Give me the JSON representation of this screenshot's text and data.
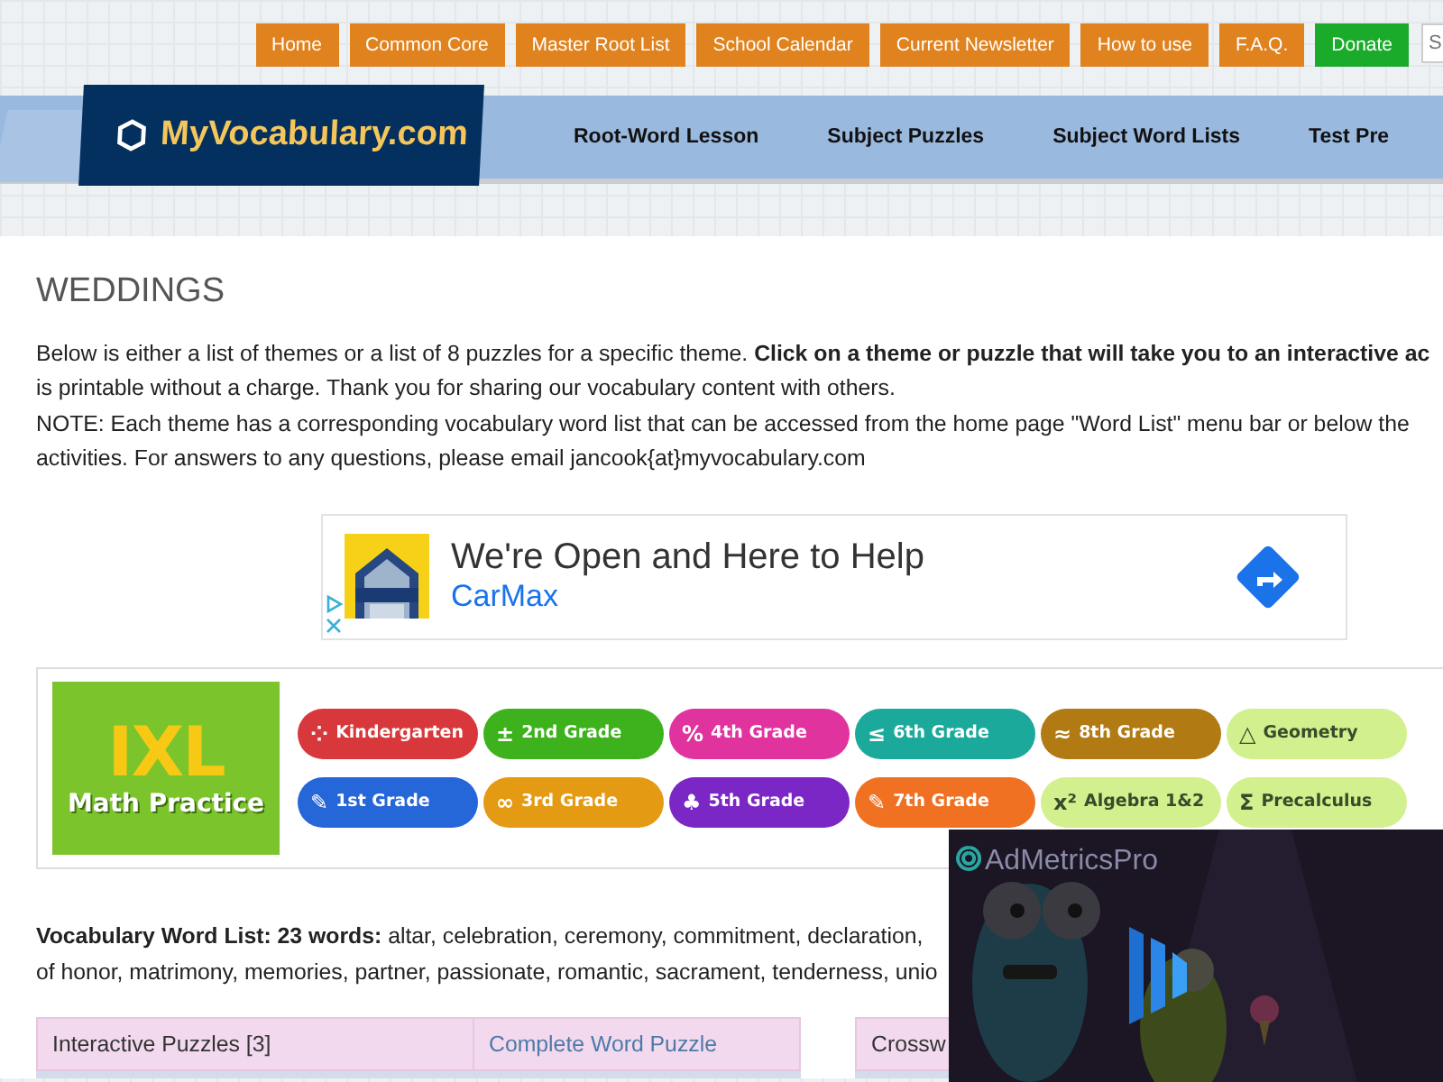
{
  "top_menu": [
    {
      "label": "Home",
      "kind": "normal"
    },
    {
      "label": "Common Core",
      "kind": "normal"
    },
    {
      "label": "Master Root List",
      "kind": "normal"
    },
    {
      "label": "School Calendar",
      "kind": "normal"
    },
    {
      "label": "Current Newsletter",
      "kind": "normal"
    },
    {
      "label": "How to use",
      "kind": "normal"
    },
    {
      "label": "F.A.Q.",
      "kind": "normal"
    },
    {
      "label": "Donate",
      "kind": "donate"
    }
  ],
  "search": {
    "placeholder": "S"
  },
  "logo": "MyVocabulary.com",
  "main_nav": [
    "Root-Word Lesson",
    "Subject Puzzles",
    "Subject Word Lists",
    "Test Pre"
  ],
  "page_title": "WEDDINGS",
  "intro": [
    "Below is either a list of themes or a list of 8 puzzles for a specific theme. **Click on a theme or puzzle that will take you to an interactive ac**",
    "is printable without a charge. Thank you for sharing our vocabulary content with others.",
    "NOTE: Each theme has a corresponding vocabulary word list that can be accessed from the home page \"Word List\" menu bar or below the",
    "activities. For answers to any questions, please email jancook{at}myvocabulary.com"
  ],
  "ad": {
    "headline": "We're Open and Here to Help",
    "advertiser": "CarMax"
  },
  "ixl_banner": {
    "logo": "IXL",
    "tagline": "Math Practice",
    "pills": [
      {
        "label": "Kindergarten",
        "symbol": "⁘",
        "color": "#d8383b",
        "kind": "dark"
      },
      {
        "label": "2nd Grade",
        "symbol": "±",
        "color": "#3db21d",
        "kind": "dark"
      },
      {
        "label": "4th Grade",
        "symbol": "%",
        "color": "#e0339e",
        "kind": "dark"
      },
      {
        "label": "6th Grade",
        "symbol": "≤",
        "color": "#1ba99b",
        "kind": "dark"
      },
      {
        "label": "8th Grade",
        "symbol": "≈",
        "color": "#b17a12",
        "kind": "dark"
      },
      {
        "label": "Geometry",
        "symbol": "△",
        "color": "#d2f08e",
        "kind": "light"
      },
      {
        "label": "1st Grade",
        "symbol": "✎",
        "color": "#2566d8",
        "kind": "dark"
      },
      {
        "label": "3rd Grade",
        "symbol": "∞",
        "color": "#e49a12",
        "kind": "dark"
      },
      {
        "label": "5th Grade",
        "symbol": "♣",
        "color": "#7b27c6",
        "kind": "dark"
      },
      {
        "label": "7th Grade",
        "symbol": "✎",
        "color": "#f07122",
        "kind": "dark"
      },
      {
        "label": "Algebra 1&2",
        "symbol": "x²",
        "color": "#d2f08e",
        "kind": "light"
      },
      {
        "label": "Precalculus",
        "symbol": "Σ",
        "color": "#d2f08e",
        "kind": "light"
      }
    ]
  },
  "video_ad": {
    "brand": "AdMetricsPro"
  },
  "vocabulary": [
    "**Vocabulary Word List: 23 words:** altar, celebration, ceremony, commitment, declaration,",
    "of honor, matrimony, memories, partner, passionate, romantic, sacrament, tenderness, unio"
  ],
  "tables": [
    {
      "rows": [
        [
          {
            "text": "Interactive Puzzles [3]",
            "kind": "text"
          },
          {
            "text": "Complete Word Puzzle",
            "kind": "link"
          }
        ]
      ]
    },
    {
      "rows": [
        [
          {
            "text": "Crossw",
            "kind": "text"
          }
        ]
      ]
    }
  ]
}
